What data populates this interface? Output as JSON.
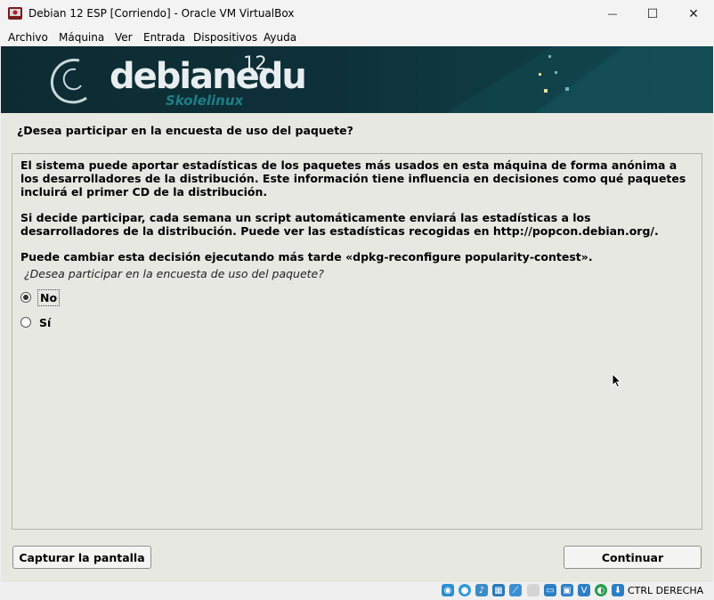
{
  "window": {
    "title": "Debian 12 ESP [Corriendo] - Oracle VM VirtualBox",
    "minimize_glyph": "—",
    "maximize_glyph": "☐",
    "close_glyph": "✕"
  },
  "menu": {
    "items": [
      "Archivo",
      "Máquina",
      "Ver",
      "Entrada",
      "Dispositivos",
      "Ayuda"
    ]
  },
  "banner": {
    "logo_text": "debianedu",
    "version": "12",
    "subtitle": "Skolelinux"
  },
  "installer": {
    "question_title": "¿Desea participar en la encuesta de uso del paquete?",
    "paragraphs": [
      "El sistema puede aportar estadísticas de los paquetes más usados en esta máquina de forma anónima a los desarrolladores de la distribución. Este información tiene influencia en decisiones como qué paquetes incluirá el primer CD de la distribución.",
      "Si decide participar, cada semana un script automáticamente enviará las estadísticas a los desarrolladores de la distribución. Puede ver las estadísticas recogidas en http://popcon.debian.org/.",
      "Puede cambiar esta decisión ejecutando más tarde «dpkg-reconfigure popularity-contest»."
    ],
    "prompt": "¿Desea participar en la encuesta de uso del paquete?",
    "options": [
      {
        "label": "No",
        "selected": true
      },
      {
        "label": "Sí",
        "selected": false
      }
    ],
    "screenshot_button": "Capturar la pantalla",
    "continue_button": "Continuar"
  },
  "statusbar": {
    "host_key": "CTRL DERECHA",
    "icons": [
      "hard-disk-icon",
      "optical-drive-icon",
      "audio-icon",
      "network-icon",
      "usb-icon",
      "shared-folders-icon",
      "display-icon",
      "video-capture-icon",
      "virtualization-icon",
      "guest-additions-icon",
      "mouse-integration-icon",
      "keyboard-icon"
    ]
  },
  "colors": {
    "banner_bg": "#0e3038",
    "installer_bg": "#e8e8e3",
    "logo_subtitle": "#1e7e86"
  }
}
